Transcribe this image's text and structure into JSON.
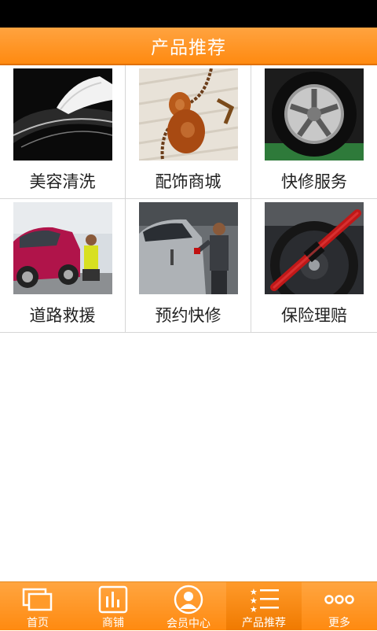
{
  "header": {
    "title": "产品推荐"
  },
  "grid": [
    {
      "label": "美容清洗",
      "image": "car-polish-photo"
    },
    {
      "label": "配饰商城",
      "image": "gourd-pendant-photo"
    },
    {
      "label": "快修服务",
      "image": "alloy-wheel-photo"
    },
    {
      "label": "道路救援",
      "image": "roadside-tire-change-photo"
    },
    {
      "label": "预约快修",
      "image": "mechanic-repair-photo"
    },
    {
      "label": "保险理赔",
      "image": "steering-wheel-lock-photo"
    }
  ],
  "tabs": [
    {
      "label": "首页",
      "icon": "home-icon"
    },
    {
      "label": "商铺",
      "icon": "shop-chart-icon"
    },
    {
      "label": "会员中心",
      "icon": "member-icon"
    },
    {
      "label": "产品推荐",
      "icon": "star-list-icon",
      "active": true
    },
    {
      "label": "更多",
      "icon": "more-dots-icon"
    }
  ],
  "colors": {
    "accent": "#ff8a10",
    "statusbar": "#000000"
  }
}
